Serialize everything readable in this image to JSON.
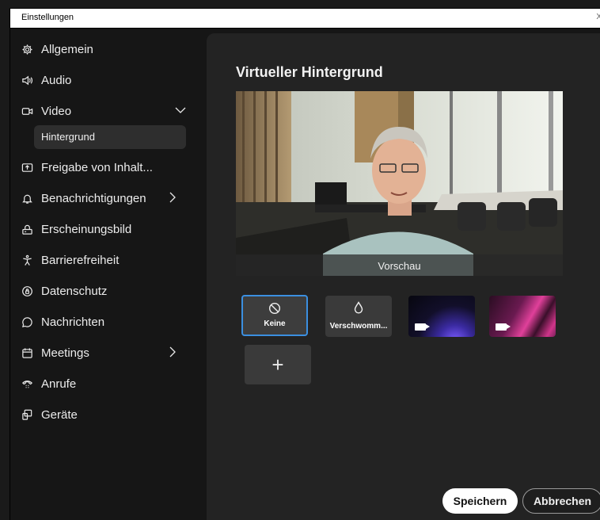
{
  "window": {
    "title": "Einstellungen",
    "close_glyph": "X"
  },
  "sidebar": {
    "items": [
      {
        "label": "Allgemein",
        "icon": "gear-icon"
      },
      {
        "label": "Audio",
        "icon": "speaker-icon"
      },
      {
        "label": "Video",
        "icon": "video-camera-icon",
        "expanded": true
      },
      {
        "label": "Freigabe von Inhalt...",
        "icon": "share-screen-icon"
      },
      {
        "label": "Benachrichtigungen",
        "icon": "bell-icon"
      },
      {
        "label": "Erscheinungsbild",
        "icon": "appearance-icon"
      },
      {
        "label": "Barrierefreiheit",
        "icon": "accessibility-icon"
      },
      {
        "label": "Datenschutz",
        "icon": "privacy-icon"
      },
      {
        "label": "Nachrichten",
        "icon": "chat-bubble-icon"
      },
      {
        "label": "Meetings",
        "icon": "calendar-icon"
      },
      {
        "label": "Anrufe",
        "icon": "phone-icon"
      },
      {
        "label": "Geräte",
        "icon": "devices-icon"
      }
    ],
    "sub_item": {
      "label": "Hintergrund",
      "selected": true
    }
  },
  "main": {
    "title": "Virtueller Hintergrund",
    "preview_label": "Vorschau",
    "backgrounds": [
      {
        "label": "Keine",
        "icon": "no-symbol-icon",
        "selected": true
      },
      {
        "label": "Verschwommen",
        "display_label": "Verschwomm...",
        "icon": "droplet-icon"
      },
      {
        "label": "",
        "icon": "video-camera-icon",
        "colors": [
          "#0b0b18",
          "#6a4cf0"
        ]
      },
      {
        "label": "",
        "icon": "video-camera-icon",
        "colors": [
          "#1a0b16",
          "#e03a8a"
        ]
      }
    ],
    "add_label": "+"
  },
  "footer": {
    "save_label": "Speichern",
    "cancel_label": "Abbrechen"
  },
  "colors": {
    "accent": "#3b8fe0",
    "sidebar_bg": "#161616",
    "content_bg": "#232323"
  }
}
